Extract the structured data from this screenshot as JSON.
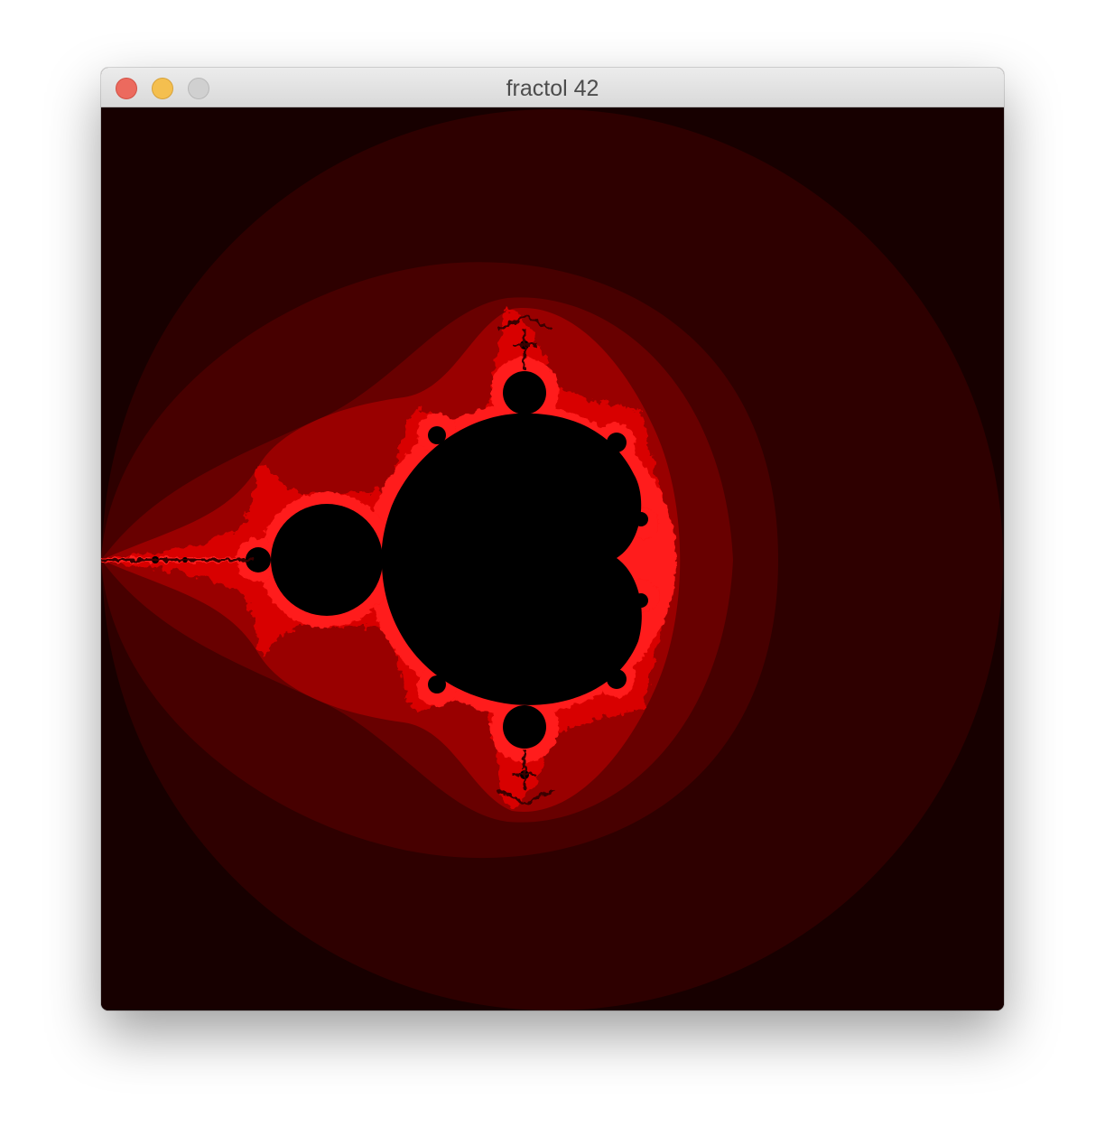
{
  "window": {
    "title": "fractol 42",
    "controls": {
      "close_icon": "close-icon",
      "minimize_icon": "minimize-icon",
      "maximize_icon": "maximize-icon"
    }
  },
  "fractal": {
    "type": "mandelbrot",
    "colors": {
      "background": "#170000",
      "band_1": "#2e0000",
      "band_2": "#470000",
      "band_3": "#680000",
      "band_4": "#990000",
      "band_5": "#d80000",
      "edge": "#ff1a1a",
      "interior": "#000000"
    }
  }
}
